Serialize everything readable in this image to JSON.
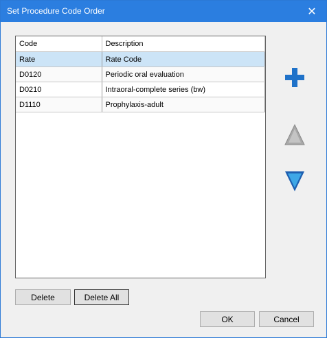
{
  "window": {
    "title": "Set Procedure Code Order",
    "close_glyph": "✕"
  },
  "grid": {
    "columns": [
      "Code",
      "Description"
    ],
    "rows": [
      {
        "code": "Rate",
        "description": "Rate Code"
      },
      {
        "code": "D0120",
        "description": "Periodic oral evaluation"
      },
      {
        "code": "D0210",
        "description": "Intraoral-complete series (bw)"
      },
      {
        "code": "D1110",
        "description": "Prophylaxis-adult"
      }
    ],
    "selected_row": 0
  },
  "side": {
    "add_icon": "plus-icon",
    "up_icon": "triangle-up-icon",
    "down_icon": "triangle-down-icon",
    "accent": "#1f72c9"
  },
  "buttons": {
    "delete": "Delete",
    "delete_all": "Delete All",
    "ok": "OK",
    "cancel": "Cancel"
  }
}
